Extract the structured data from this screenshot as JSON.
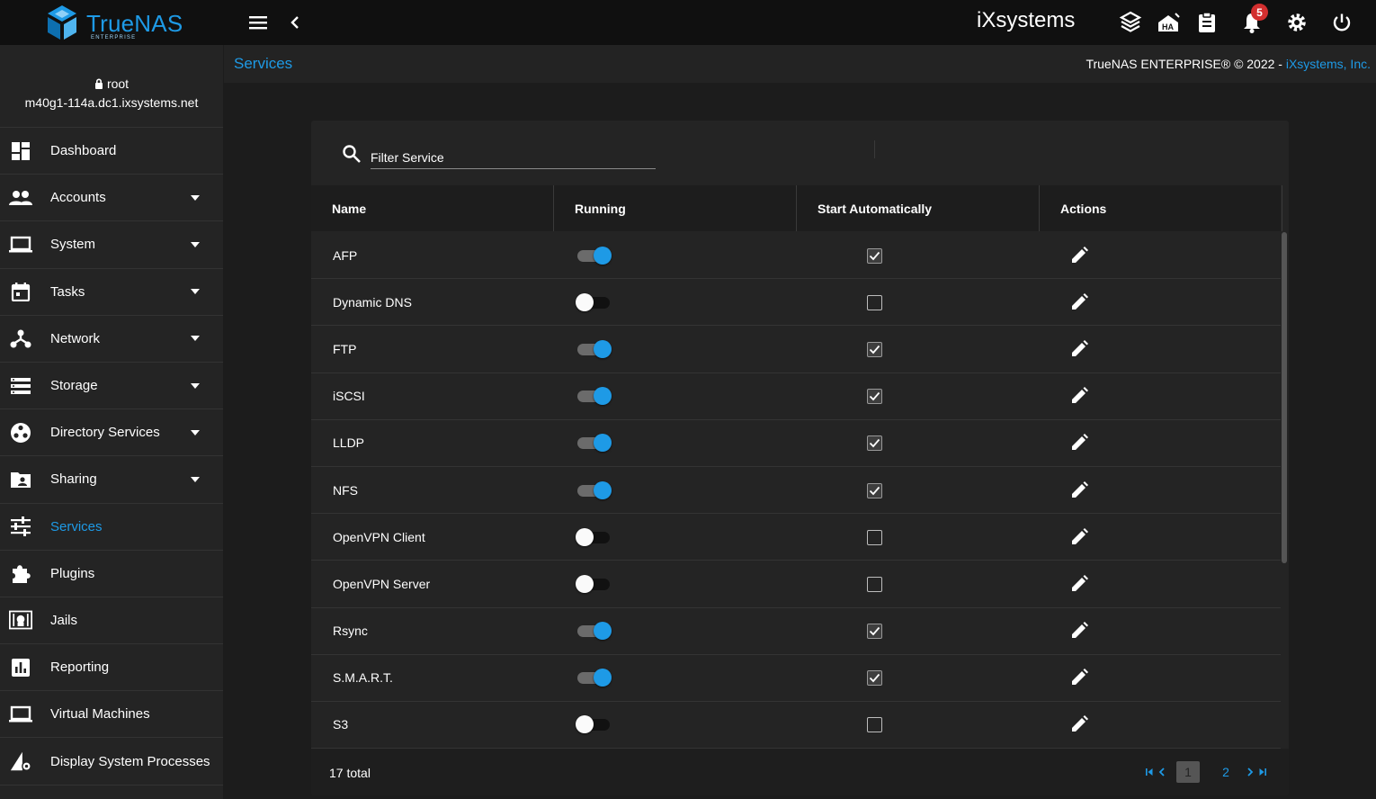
{
  "app": {
    "brand": "TrueNAS",
    "edition": "ENTERPRISE",
    "vendor_logo": "iXsystems",
    "notifications_count": "5"
  },
  "topbar": {
    "icons": [
      "menu-icon",
      "back-arrow-icon",
      "truecommand-icon",
      "ha-status-icon",
      "tasks-clipboard-icon",
      "notifications-bell-icon",
      "settings-gear-icon",
      "power-icon"
    ]
  },
  "user": {
    "name": "root",
    "host": "m40g1-114a.dc1.ixsystems.net"
  },
  "sidebar": {
    "items": [
      {
        "label": "Dashboard",
        "icon": "dashboard-icon",
        "expandable": false
      },
      {
        "label": "Accounts",
        "icon": "accounts-icon",
        "expandable": true
      },
      {
        "label": "System",
        "icon": "system-laptop-icon",
        "expandable": true
      },
      {
        "label": "Tasks",
        "icon": "calendar-icon",
        "expandable": true
      },
      {
        "label": "Network",
        "icon": "network-icon",
        "expandable": true
      },
      {
        "label": "Storage",
        "icon": "storage-icon",
        "expandable": true
      },
      {
        "label": "Directory Services",
        "icon": "directory-services-icon",
        "expandable": true
      },
      {
        "label": "Sharing",
        "icon": "sharing-folder-icon",
        "expandable": true
      },
      {
        "label": "Services",
        "icon": "services-sliders-icon",
        "expandable": false,
        "active": true
      },
      {
        "label": "Plugins",
        "icon": "puzzle-icon",
        "expandable": false
      },
      {
        "label": "Jails",
        "icon": "jail-icon",
        "expandable": false
      },
      {
        "label": "Reporting",
        "icon": "reporting-chart-icon",
        "expandable": false
      },
      {
        "label": "Virtual Machines",
        "icon": "vm-laptop-icon",
        "expandable": false
      },
      {
        "label": "Display System Processes",
        "icon": "processes-icon",
        "expandable": false
      }
    ]
  },
  "breadcrumb": {
    "current": "Services"
  },
  "copyright": {
    "text": "TrueNAS ENTERPRISE® © 2022 - ",
    "link": "iXsystems, Inc."
  },
  "filter": {
    "placeholder": "Filter Service"
  },
  "table": {
    "headers": [
      "Name",
      "Running",
      "Start Automatically",
      "Actions"
    ],
    "rows": [
      {
        "name": "AFP",
        "running": true,
        "auto": true
      },
      {
        "name": "Dynamic DNS",
        "running": false,
        "auto": false
      },
      {
        "name": "FTP",
        "running": true,
        "auto": true
      },
      {
        "name": "iSCSI",
        "running": true,
        "auto": true
      },
      {
        "name": "LLDP",
        "running": true,
        "auto": true
      },
      {
        "name": "NFS",
        "running": true,
        "auto": true
      },
      {
        "name": "OpenVPN Client",
        "running": false,
        "auto": false
      },
      {
        "name": "OpenVPN Server",
        "running": false,
        "auto": false
      },
      {
        "name": "Rsync",
        "running": true,
        "auto": true
      },
      {
        "name": "S.M.A.R.T.",
        "running": true,
        "auto": true
      },
      {
        "name": "S3",
        "running": false,
        "auto": false
      }
    ]
  },
  "footer": {
    "total": "17 total",
    "pages": [
      "1",
      "2"
    ],
    "current_page": "1"
  },
  "colors": {
    "accent": "#1e9ae6",
    "topbar": "#101010",
    "sidebar": "#242424",
    "card": "#242424",
    "badge": "#d32f2f"
  }
}
